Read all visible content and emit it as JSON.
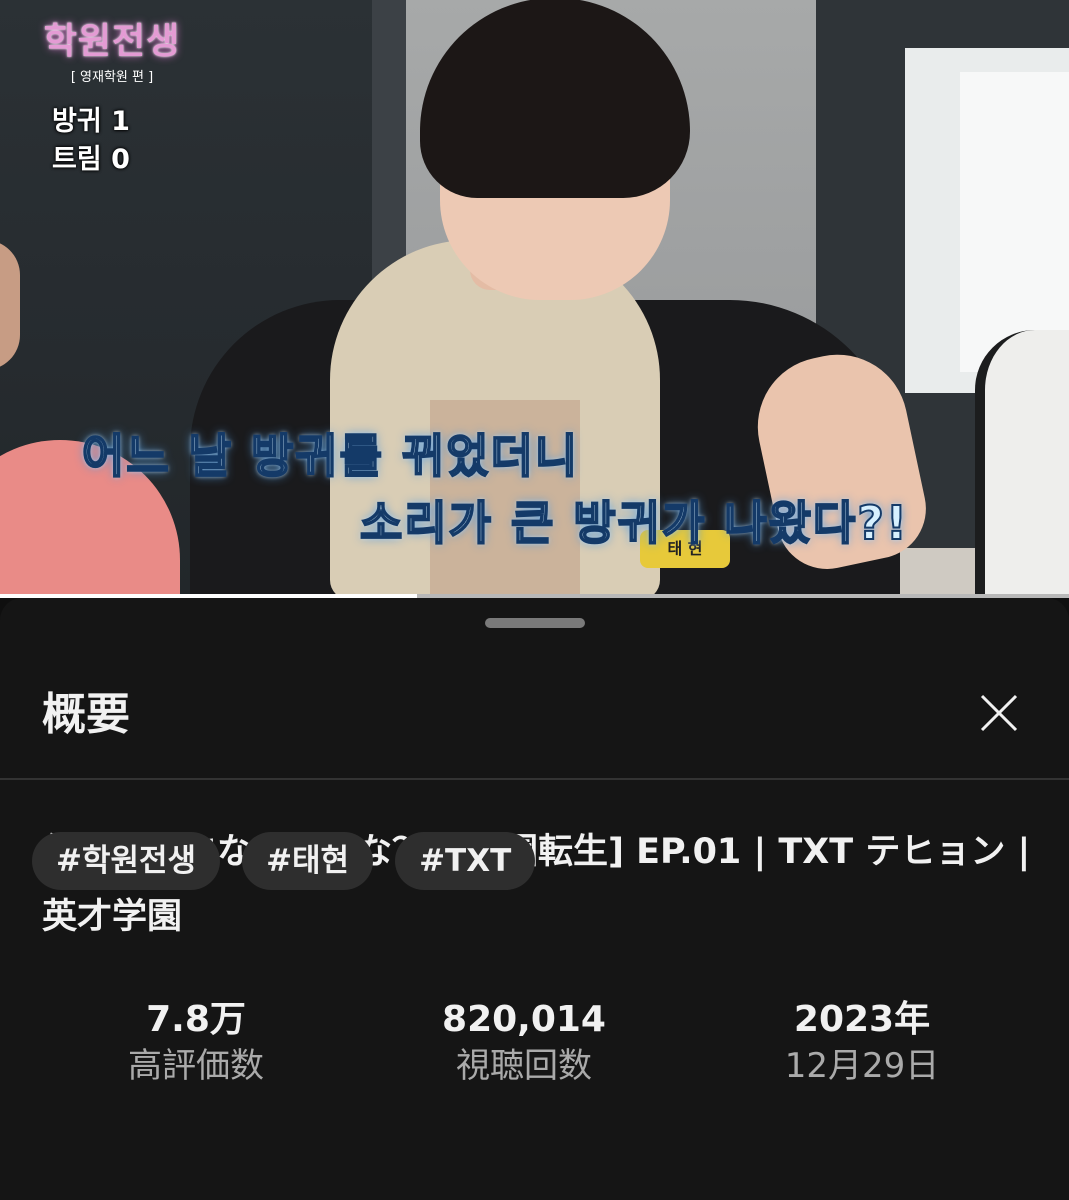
{
  "video": {
    "logo_title": "학원전생",
    "logo_subtitle": "[ 영재학원 편 ]",
    "score_line_1": "방귀 1",
    "score_line_2": "트림 0",
    "caption_line_1": "어느 날 방귀를 뀌었더니",
    "caption_line_2": "소리가 큰 방귀가 나왔다?!",
    "name_tag": "태 현",
    "progress_percent": 39,
    "colors": {
      "caption": "#d6f0ff",
      "caption_outline": "#143a68",
      "logo": "#e49bd4"
    }
  },
  "sheet": {
    "title": "概要",
    "close_icon": "close-icon",
    "video_title": "僕が英才になれるかな？| [学園転生] EP.01 | TXT テヒョン | 英才学園",
    "stats": {
      "likes_value": "7.8万",
      "likes_label": "高評価数",
      "views_value": "820,014",
      "views_label": "視聴回数",
      "year_value": "2023年",
      "date_label": "12月29日"
    },
    "tags": [
      "#학원전생",
      "#태현",
      "#TXT"
    ]
  }
}
